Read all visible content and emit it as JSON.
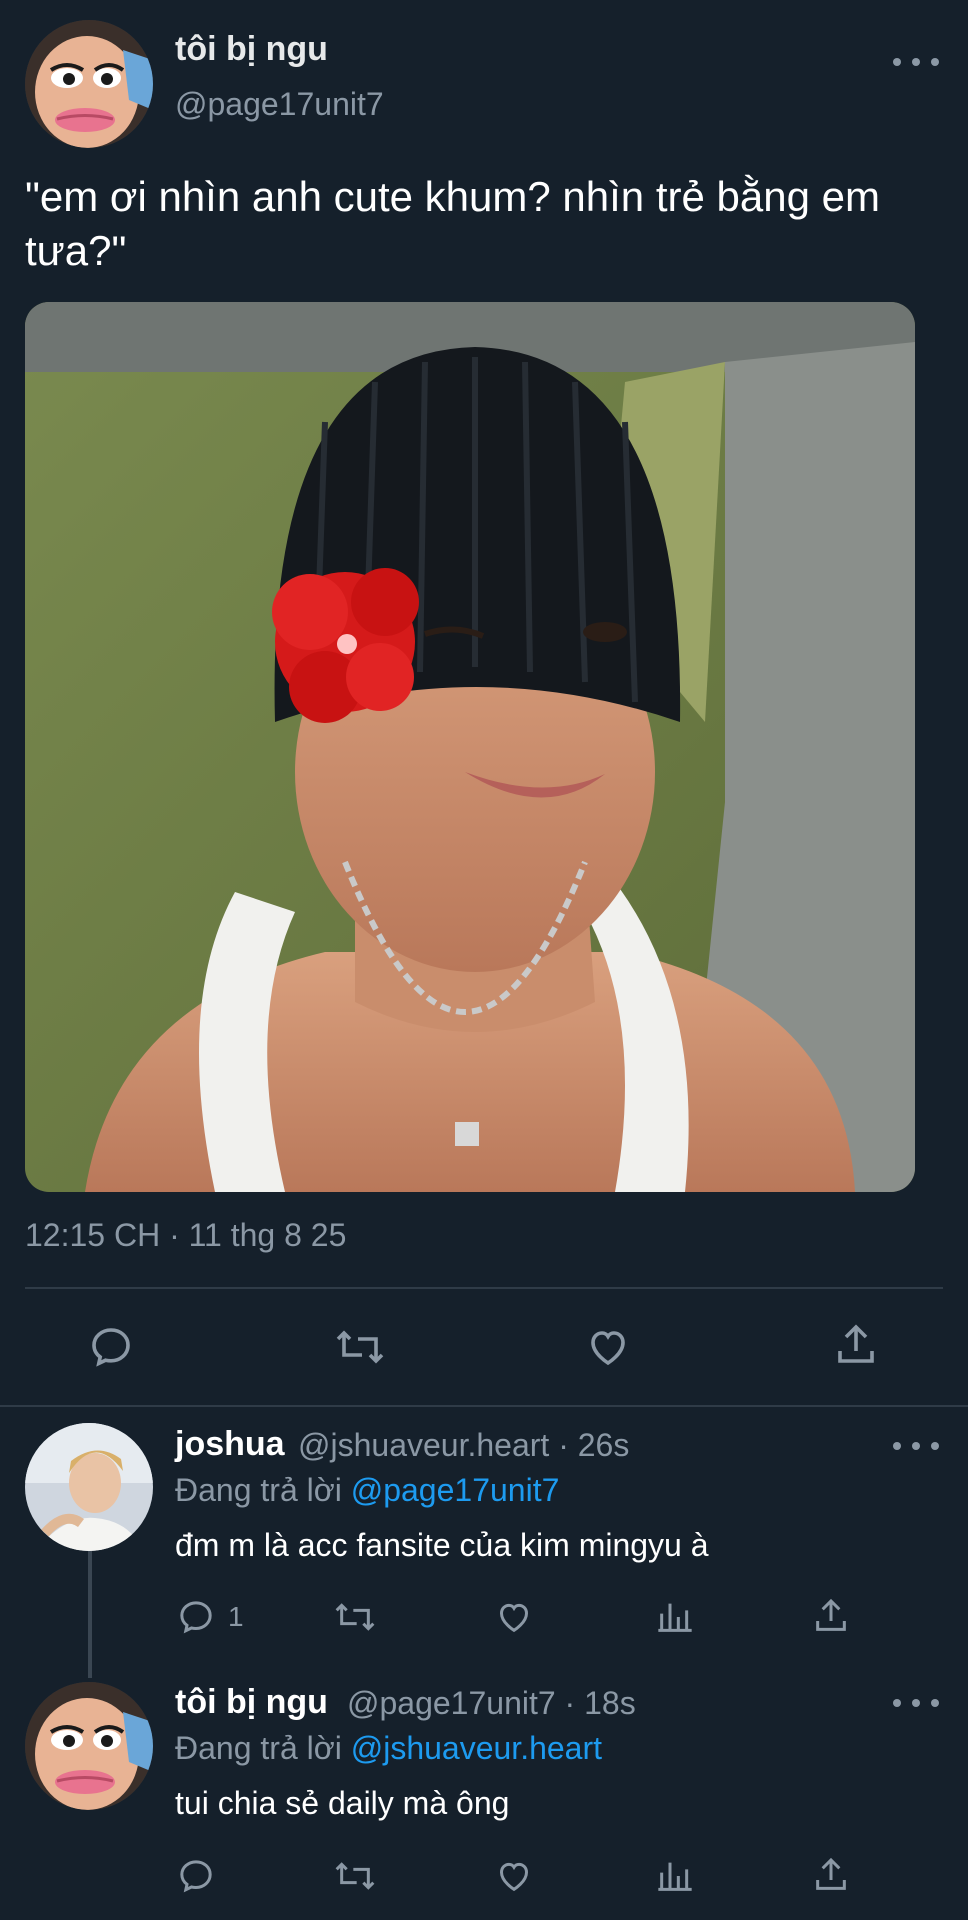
{
  "main_tweet": {
    "display_name": "tôi bị ngu",
    "handle": "@page17unit7",
    "text": "\"em ơi nhìn anh cute khum? nhìn trẻ bằng em tưa?\"",
    "timestamp": "12:15 CH · 11 thg 8 25",
    "icons": [
      "reply-icon",
      "retweet-icon",
      "like-icon",
      "share-icon",
      "more-icon"
    ]
  },
  "replies": [
    {
      "display_name": "joshua",
      "meta": "@jshuaveur.heart · 26s",
      "replying_label": "Đang trả lời",
      "replying_to": "@page17unit7",
      "text": "đm m là acc fansite của kim mingyu à",
      "reply_count": "1"
    },
    {
      "display_name": "tôi bị ngu",
      "meta": "@page17unit7 · 18s",
      "replying_label": "Đang trả lời",
      "replying_to": "@jshuaveur.heart",
      "text": "tui chia sẻ daily mà ông",
      "reply_count": ""
    }
  ],
  "colors": {
    "background": "#15202b",
    "text": "#e7e9ea",
    "muted": "#8b98a5",
    "link": "#1d9bf0",
    "divider": "#2f3b47"
  }
}
